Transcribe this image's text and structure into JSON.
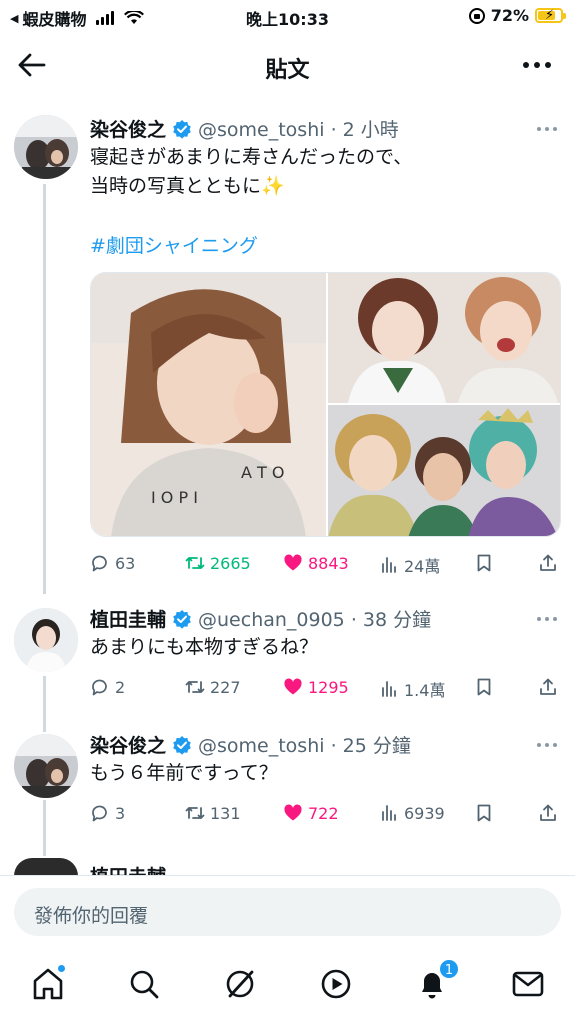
{
  "status_bar": {
    "back_app": "蝦皮購物",
    "time": "晚上10:33",
    "battery": "72%"
  },
  "header": {
    "title": "貼文"
  },
  "posts": [
    {
      "name": "染谷俊之",
      "handle_time": "@some_toshi · 2 小時",
      "text": "寝起きがあまりに寿さんだったので、\n当時の写真とともに✨",
      "hashtag": "#劇団シャイニング",
      "replies": "63",
      "retweets": "2665",
      "likes": "8843",
      "views": "24萬"
    },
    {
      "name": "植田圭輔",
      "handle_time": "@uechan_0905 · 38 分鐘",
      "text": "あまりにも本物すぎるね？",
      "replies": "2",
      "retweets": "227",
      "likes": "1295",
      "views": "1.4萬"
    },
    {
      "name": "染谷俊之",
      "handle_time": "@some_toshi · 25 分鐘",
      "text": "もう６年前ですって？",
      "replies": "3",
      "retweets": "131",
      "likes": "722",
      "views": "6939"
    }
  ],
  "peek": {
    "name": "植田圭輔"
  },
  "reply": {
    "placeholder": "發佈你的回覆"
  },
  "tabbar": {
    "notifications_badge": "1"
  },
  "colors": {
    "accent": "#1d9bf0",
    "like": "#f91880",
    "retweet": "#00ba7c",
    "muted": "#536471"
  },
  "icons": [
    "back-arrow-icon",
    "more-icon",
    "verified-icon",
    "reply-icon",
    "retweet-icon",
    "like-icon",
    "views-icon",
    "bookmark-icon",
    "share-icon",
    "home-icon",
    "search-icon",
    "grok-icon",
    "video-icon",
    "bell-icon",
    "mail-icon"
  ]
}
